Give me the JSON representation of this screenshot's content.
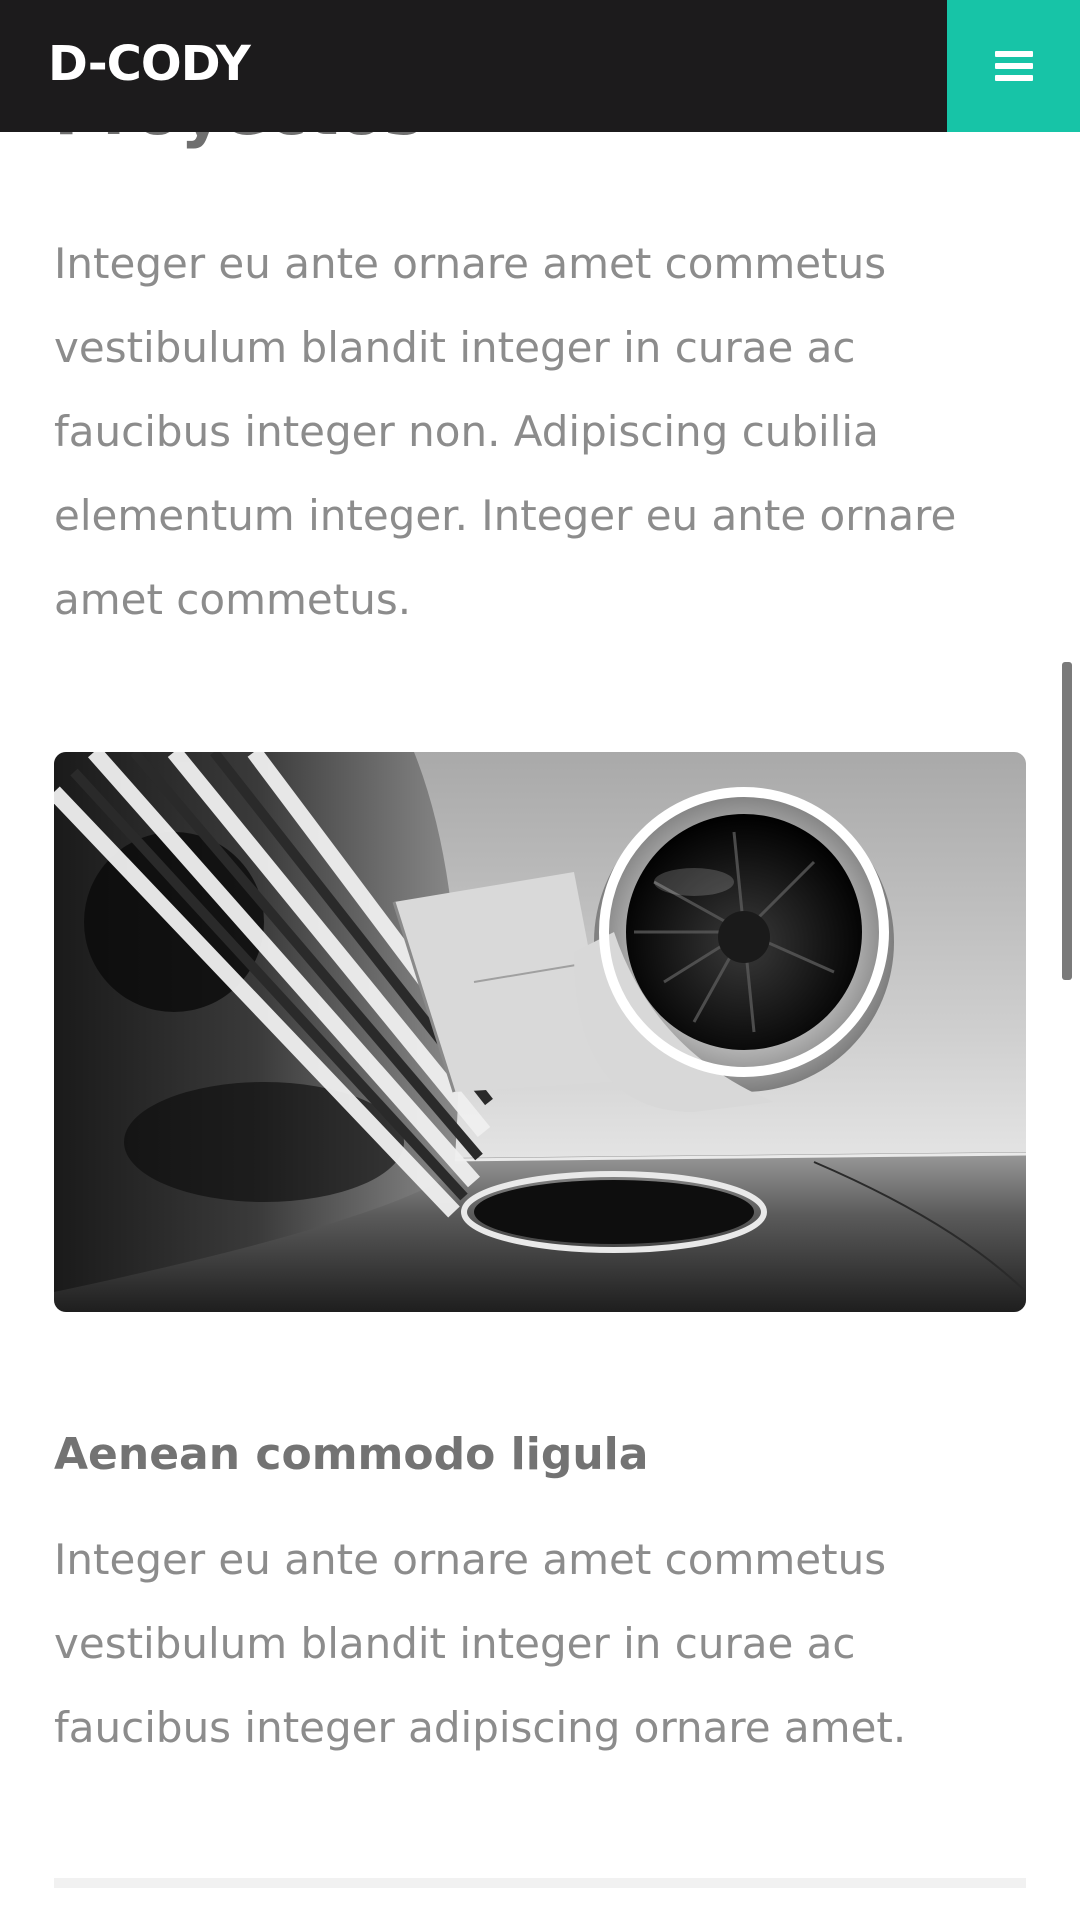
{
  "header": {
    "logo": "D-CODY",
    "menu_icon": "hamburger-menu-icon",
    "background_color": "#1c1b1c",
    "accent_color": "#17c4a7"
  },
  "main": {
    "title": "Proyectos",
    "intro": "Integer eu ante ornare amet commetus vestibulum blandit integer in curae ac faucibus integer non. Adipiscing cubilia elementum integer. Integer eu ante ornare amet commetus.",
    "image": "jet-engine-photo",
    "article": {
      "title": "Aenean commodo ligula",
      "text": "Integer eu ante ornare amet commetus vestibulum blandit integer in curae ac faucibus integer adipiscing ornare amet."
    }
  },
  "scrollbar": {
    "color": "#7a7a7a"
  }
}
